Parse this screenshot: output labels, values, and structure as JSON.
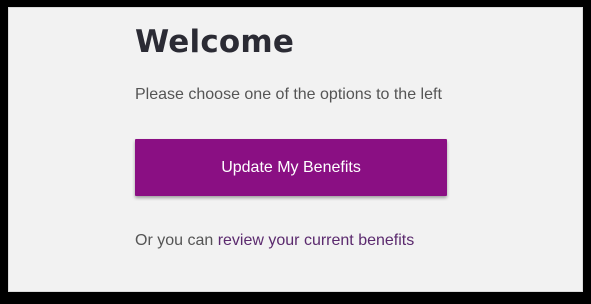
{
  "welcome": {
    "title": "Welcome",
    "subtitle": "Please choose one of the options to the left",
    "update_button_label": "Update My Benefits",
    "alt_prefix": "Or you can ",
    "review_link_label": "review your current benefits"
  },
  "colors": {
    "button_background": "#8a0f83",
    "link": "#5b2a6e",
    "panel_background": "#f2f2f2",
    "frame": "#000000"
  }
}
